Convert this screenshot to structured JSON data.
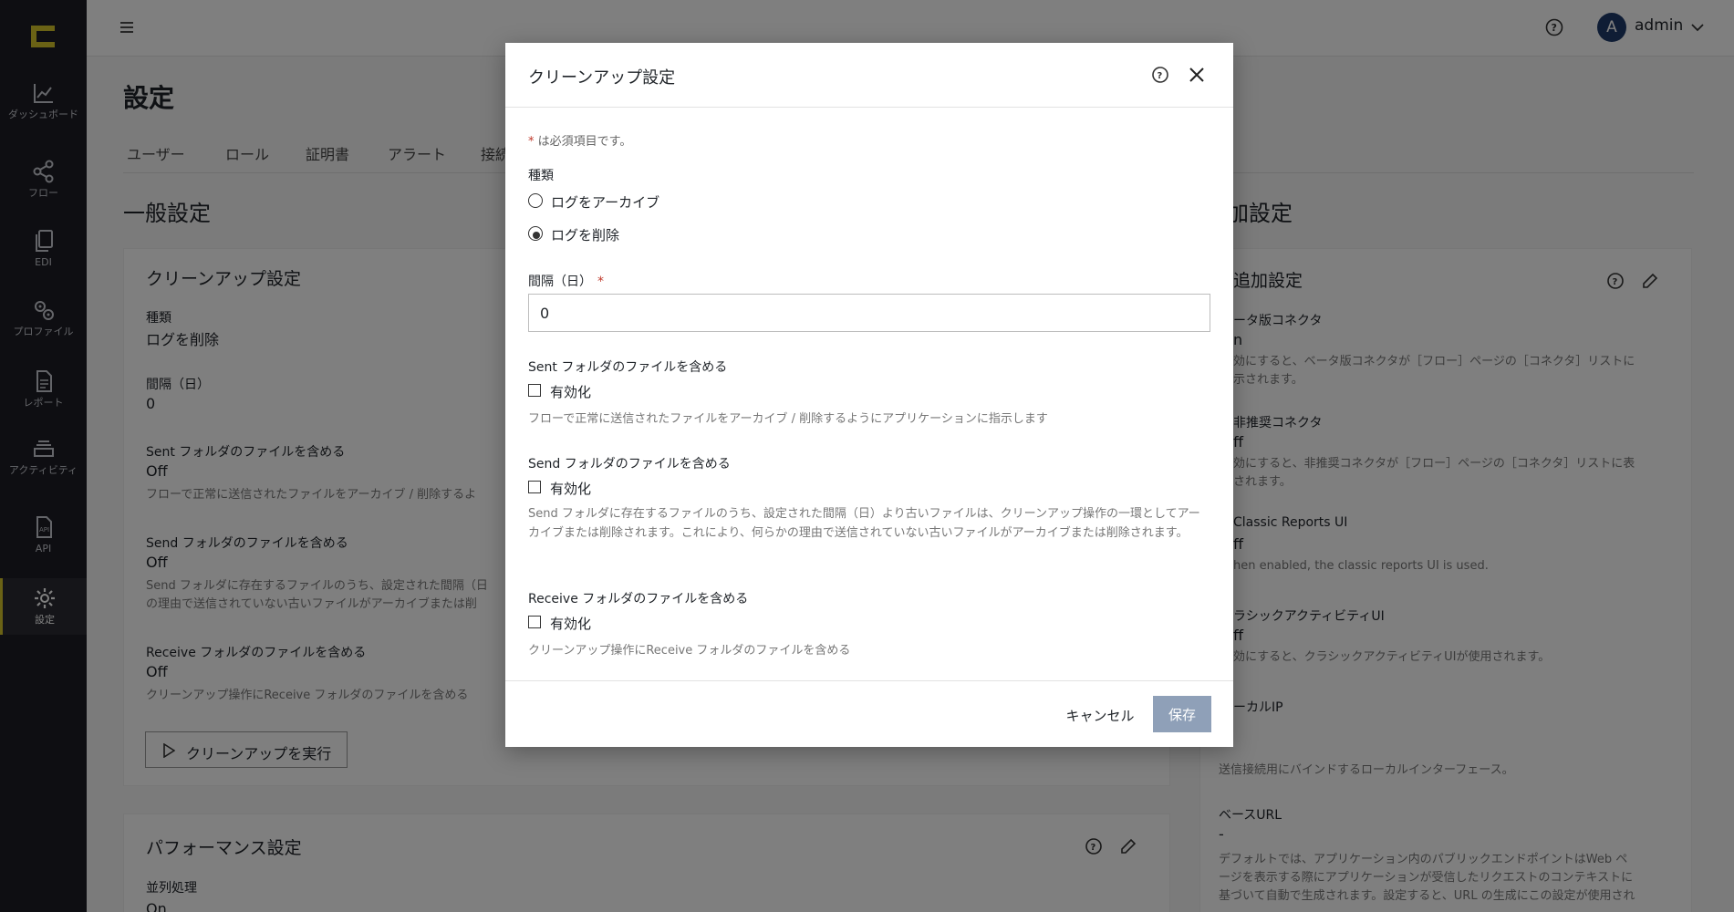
{
  "colors": {
    "sidebar_bg": "#1c1d24",
    "accent": "#d4c52a",
    "primary_disabled": "#8fa0b8",
    "required": "#c0392b"
  },
  "sidebar": {
    "items": [
      {
        "label": "ダッシュボード",
        "icon": "chart-line-icon"
      },
      {
        "label": "フロー",
        "icon": "share-nodes-icon"
      },
      {
        "label": "EDI",
        "icon": "documents-icon"
      },
      {
        "label": "プロファイル",
        "icon": "gears-icon"
      },
      {
        "label": "レポート",
        "icon": "report-icon"
      },
      {
        "label": "アクティビティ",
        "icon": "layers-icon"
      },
      {
        "label": "API",
        "icon": "api-file-icon"
      },
      {
        "label": "設定",
        "icon": "gear-icon",
        "active": true
      }
    ]
  },
  "topbar": {
    "user": {
      "initial": "A",
      "name": "admin"
    }
  },
  "page": {
    "title": "設定",
    "tabs": [
      "ユーザー",
      "ロール",
      "証明書",
      "アラート",
      "接続"
    ],
    "left_section": {
      "title": "一般設定",
      "cleanup_card": {
        "title": "クリーンアップ設定",
        "type_label": "種類",
        "type_value": "ログを削除",
        "interval_label": "間隔（日）",
        "interval_value": "0",
        "sent_label": "Sent フォルダのファイルを含める",
        "sent_value": "Off",
        "sent_help": "フローで正常に送信されたファイルをアーカイブ / 削除するよ",
        "send_label": "Send フォルダのファイルを含める",
        "send_value": "Off",
        "send_help_1": "Send フォルダに存在するファイルのうち、設定された間隔（日",
        "send_help_2": "の理由で送信されていない古いファイルがアーカイブまたは削",
        "receive_label": "Receive フォルダのファイルを含める",
        "receive_value": "Off",
        "receive_help": "クリーンアップ操作にReceive フォルダのファイルを含める",
        "run_button": "クリーンアップを実行"
      },
      "performance_card": {
        "title": "パフォーマンス設定",
        "parallel_label": "並列処理",
        "parallel_value": "On"
      }
    },
    "right_section": {
      "title": "加設定",
      "advanced_card": {
        "title": "追加設定",
        "beta_label": "ータ版コネクタ",
        "beta_value": "n",
        "beta_help_1": "効にすると、ベータ版コネクタが［フロー］ページの［コネクタ］リストに",
        "beta_help_2": "示されます。",
        "deprecated_label": "非推奨コネクタ",
        "deprecated_value": "ff",
        "deprecated_help_1": "効にすると、非推奨コネクタが［フロー］ページの［コネクタ］リストに表",
        "deprecated_help_2": "されます。",
        "classic_reports_label": "Classic Reports UI",
        "classic_reports_value": "ff",
        "classic_reports_help": "hen enabled, the classic reports UI is used.",
        "classic_activity_label": "ラシックアクティビティUI",
        "classic_activity_value": "ff",
        "classic_activity_help": "効にすると、クラシックアクティビティUIが使用されます。",
        "local_ip_label": "ーカルIP",
        "local_ip_help": "送信接続用にバインドするローカルインターフェース。",
        "base_url_label": "ベースURL",
        "base_url_value": "-",
        "base_url_help_1": "デフォルトでは、アプリケーション内のパブリックエンドポイントはWeb ペ",
        "base_url_help_2": "ージを表示する際にアプリケーションが受信したリクエストのコンテキストに",
        "base_url_help_3": "基づいて自動で生成されます。設定すると、URL の生成にこの設定が使用され"
      }
    }
  },
  "modal": {
    "title": "クリーンアップ設定",
    "required_note_star": "*",
    "required_note_text": " は必須項目です。",
    "type_label": "種類",
    "type_options": [
      {
        "label": "ログをアーカイブ",
        "selected": false
      },
      {
        "label": "ログを削除",
        "selected": true
      }
    ],
    "interval_label": "間隔（日）",
    "interval_required": "*",
    "interval_value": "0",
    "sent_label": "Sent フォルダのファイルを含める",
    "sent_checkbox": "有効化",
    "sent_help": "フローで正常に送信されたファイルをアーカイブ / 削除するようにアプリケーションに指示します",
    "send_label": "Send フォルダのファイルを含める",
    "send_checkbox": "有効化",
    "send_help": "Send フォルダに存在するファイルのうち、設定された間隔（日）より古いファイルは、クリーンアップ操作の一環としてアーカイブまたは削除されます。これにより、何らかの理由で送信されていない古いファイルがアーカイブまたは削除されます。",
    "receive_label": "Receive フォルダのファイルを含める",
    "receive_checkbox": "有効化",
    "receive_help": "クリーンアップ操作にReceive フォルダのファイルを含める",
    "cancel_label": "キャンセル",
    "save_label": "保存"
  }
}
